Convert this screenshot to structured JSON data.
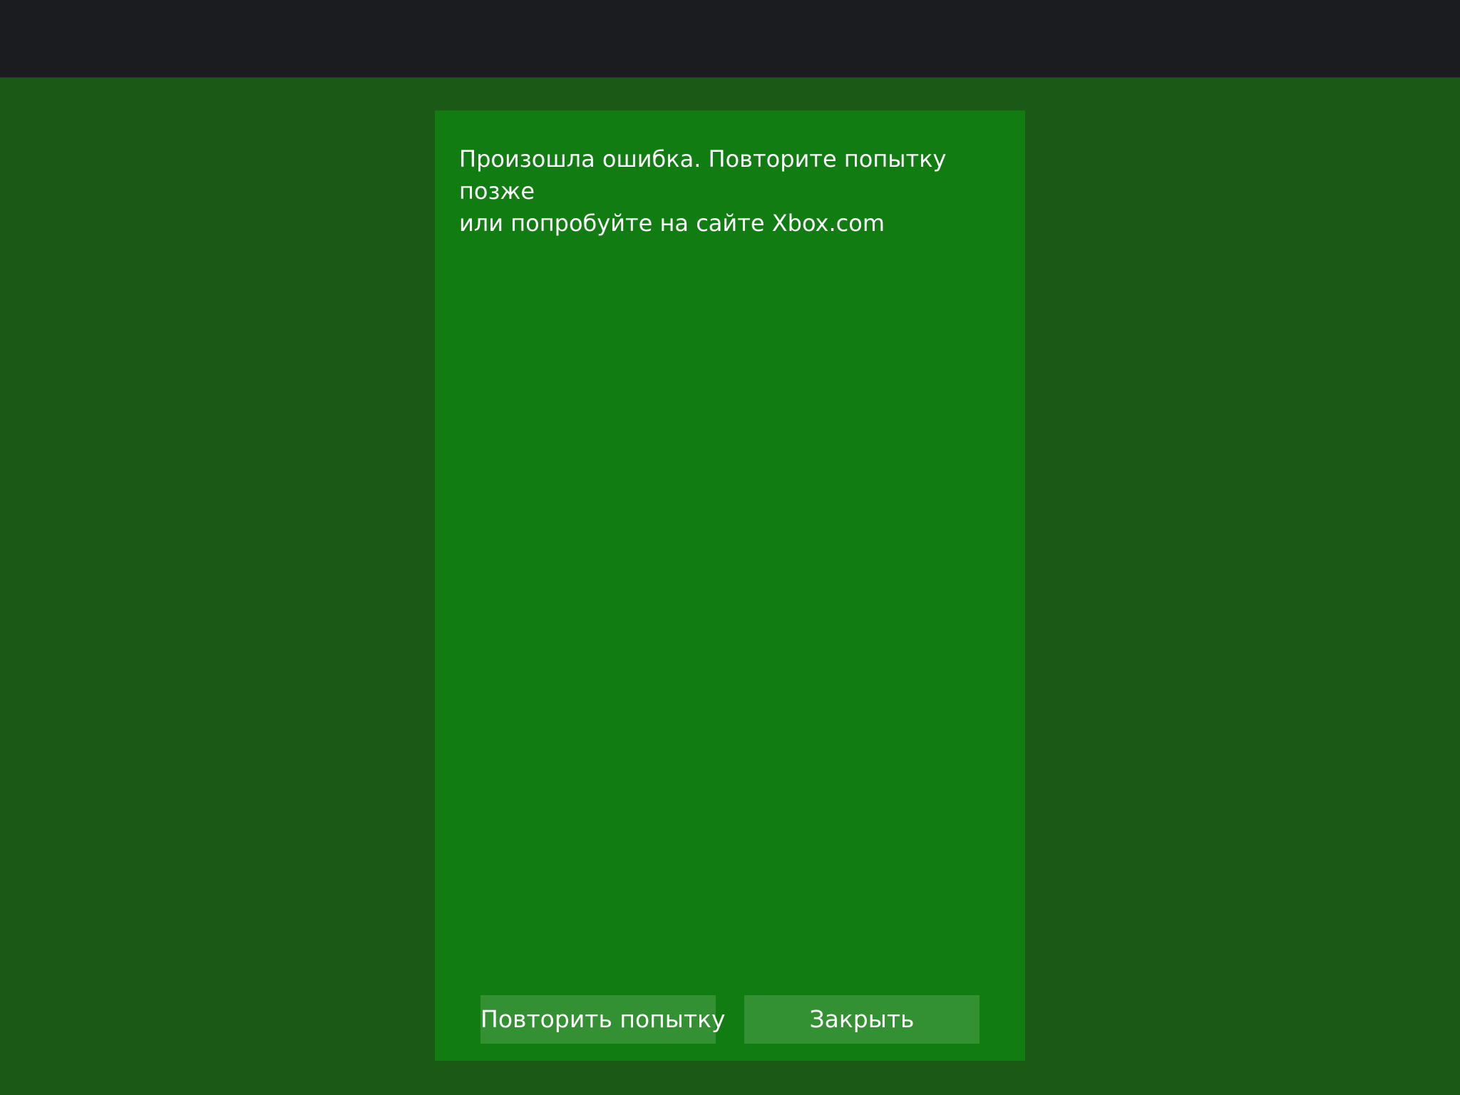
{
  "dialog": {
    "message_line1": "Произошла ошибка. Повторите попытку позже",
    "message_line2": "или попробуйте на сайте Xbox.com",
    "retry_label": "Повторить попытку",
    "close_label": "Закрыть"
  },
  "colors": {
    "top_bar": "#1b1c1f",
    "backdrop": "#1a5a16",
    "dialog_background": "#107c12",
    "button_background": "#339133",
    "text": "#ffffff"
  }
}
